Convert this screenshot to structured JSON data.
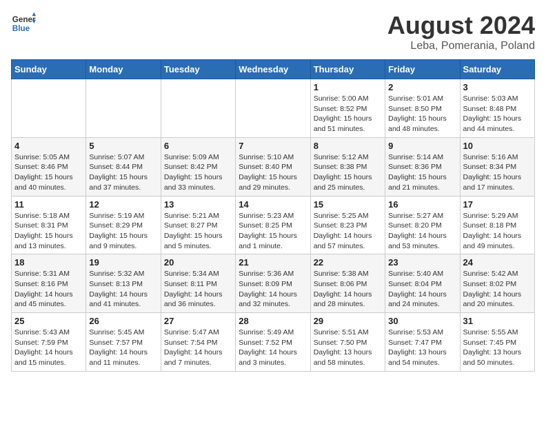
{
  "header": {
    "logo_line1": "General",
    "logo_line2": "Blue",
    "main_title": "August 2024",
    "subtitle": "Leba, Pomerania, Poland"
  },
  "weekdays": [
    "Sunday",
    "Monday",
    "Tuesday",
    "Wednesday",
    "Thursday",
    "Friday",
    "Saturday"
  ],
  "weeks": [
    [
      {
        "day": "",
        "info": ""
      },
      {
        "day": "",
        "info": ""
      },
      {
        "day": "",
        "info": ""
      },
      {
        "day": "",
        "info": ""
      },
      {
        "day": "1",
        "info": "Sunrise: 5:00 AM\nSunset: 8:52 PM\nDaylight: 15 hours and 51 minutes."
      },
      {
        "day": "2",
        "info": "Sunrise: 5:01 AM\nSunset: 8:50 PM\nDaylight: 15 hours and 48 minutes."
      },
      {
        "day": "3",
        "info": "Sunrise: 5:03 AM\nSunset: 8:48 PM\nDaylight: 15 hours and 44 minutes."
      }
    ],
    [
      {
        "day": "4",
        "info": "Sunrise: 5:05 AM\nSunset: 8:46 PM\nDaylight: 15 hours and 40 minutes."
      },
      {
        "day": "5",
        "info": "Sunrise: 5:07 AM\nSunset: 8:44 PM\nDaylight: 15 hours and 37 minutes."
      },
      {
        "day": "6",
        "info": "Sunrise: 5:09 AM\nSunset: 8:42 PM\nDaylight: 15 hours and 33 minutes."
      },
      {
        "day": "7",
        "info": "Sunrise: 5:10 AM\nSunset: 8:40 PM\nDaylight: 15 hours and 29 minutes."
      },
      {
        "day": "8",
        "info": "Sunrise: 5:12 AM\nSunset: 8:38 PM\nDaylight: 15 hours and 25 minutes."
      },
      {
        "day": "9",
        "info": "Sunrise: 5:14 AM\nSunset: 8:36 PM\nDaylight: 15 hours and 21 minutes."
      },
      {
        "day": "10",
        "info": "Sunrise: 5:16 AM\nSunset: 8:34 PM\nDaylight: 15 hours and 17 minutes."
      }
    ],
    [
      {
        "day": "11",
        "info": "Sunrise: 5:18 AM\nSunset: 8:31 PM\nDaylight: 15 hours and 13 minutes."
      },
      {
        "day": "12",
        "info": "Sunrise: 5:19 AM\nSunset: 8:29 PM\nDaylight: 15 hours and 9 minutes."
      },
      {
        "day": "13",
        "info": "Sunrise: 5:21 AM\nSunset: 8:27 PM\nDaylight: 15 hours and 5 minutes."
      },
      {
        "day": "14",
        "info": "Sunrise: 5:23 AM\nSunset: 8:25 PM\nDaylight: 15 hours and 1 minute."
      },
      {
        "day": "15",
        "info": "Sunrise: 5:25 AM\nSunset: 8:23 PM\nDaylight: 14 hours and 57 minutes."
      },
      {
        "day": "16",
        "info": "Sunrise: 5:27 AM\nSunset: 8:20 PM\nDaylight: 14 hours and 53 minutes."
      },
      {
        "day": "17",
        "info": "Sunrise: 5:29 AM\nSunset: 8:18 PM\nDaylight: 14 hours and 49 minutes."
      }
    ],
    [
      {
        "day": "18",
        "info": "Sunrise: 5:31 AM\nSunset: 8:16 PM\nDaylight: 14 hours and 45 minutes."
      },
      {
        "day": "19",
        "info": "Sunrise: 5:32 AM\nSunset: 8:13 PM\nDaylight: 14 hours and 41 minutes."
      },
      {
        "day": "20",
        "info": "Sunrise: 5:34 AM\nSunset: 8:11 PM\nDaylight: 14 hours and 36 minutes."
      },
      {
        "day": "21",
        "info": "Sunrise: 5:36 AM\nSunset: 8:09 PM\nDaylight: 14 hours and 32 minutes."
      },
      {
        "day": "22",
        "info": "Sunrise: 5:38 AM\nSunset: 8:06 PM\nDaylight: 14 hours and 28 minutes."
      },
      {
        "day": "23",
        "info": "Sunrise: 5:40 AM\nSunset: 8:04 PM\nDaylight: 14 hours and 24 minutes."
      },
      {
        "day": "24",
        "info": "Sunrise: 5:42 AM\nSunset: 8:02 PM\nDaylight: 14 hours and 20 minutes."
      }
    ],
    [
      {
        "day": "25",
        "info": "Sunrise: 5:43 AM\nSunset: 7:59 PM\nDaylight: 14 hours and 15 minutes."
      },
      {
        "day": "26",
        "info": "Sunrise: 5:45 AM\nSunset: 7:57 PM\nDaylight: 14 hours and 11 minutes."
      },
      {
        "day": "27",
        "info": "Sunrise: 5:47 AM\nSunset: 7:54 PM\nDaylight: 14 hours and 7 minutes."
      },
      {
        "day": "28",
        "info": "Sunrise: 5:49 AM\nSunset: 7:52 PM\nDaylight: 14 hours and 3 minutes."
      },
      {
        "day": "29",
        "info": "Sunrise: 5:51 AM\nSunset: 7:50 PM\nDaylight: 13 hours and 58 minutes."
      },
      {
        "day": "30",
        "info": "Sunrise: 5:53 AM\nSunset: 7:47 PM\nDaylight: 13 hours and 54 minutes."
      },
      {
        "day": "31",
        "info": "Sunrise: 5:55 AM\nSunset: 7:45 PM\nDaylight: 13 hours and 50 minutes."
      }
    ]
  ]
}
